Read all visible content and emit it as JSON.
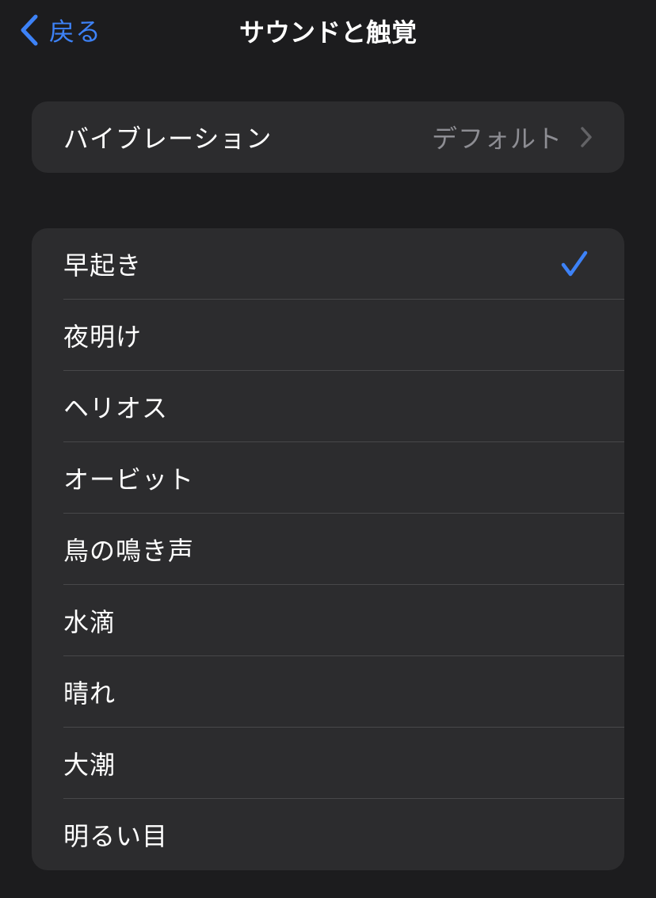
{
  "nav": {
    "back_label": "戻る",
    "title": "サウンドと触覚"
  },
  "vibration": {
    "label": "バイブレーション",
    "value": "デフォルト"
  },
  "tones": [
    {
      "label": "早起き",
      "selected": true
    },
    {
      "label": "夜明け",
      "selected": false
    },
    {
      "label": "ヘリオス",
      "selected": false
    },
    {
      "label": "オービット",
      "selected": false
    },
    {
      "label": "鳥の鳴き声",
      "selected": false
    },
    {
      "label": "水滴",
      "selected": false
    },
    {
      "label": "晴れ",
      "selected": false
    },
    {
      "label": "大潮",
      "selected": false
    },
    {
      "label": "明るい目",
      "selected": false
    }
  ],
  "colors": {
    "accent": "#3d82f7",
    "background": "#1c1c1e",
    "cell": "#2c2c2e",
    "secondary_text": "#8d8d93"
  },
  "icons": {
    "back": "chevron-left-icon",
    "disclosure": "chevron-right-icon",
    "selected": "checkmark-icon"
  }
}
